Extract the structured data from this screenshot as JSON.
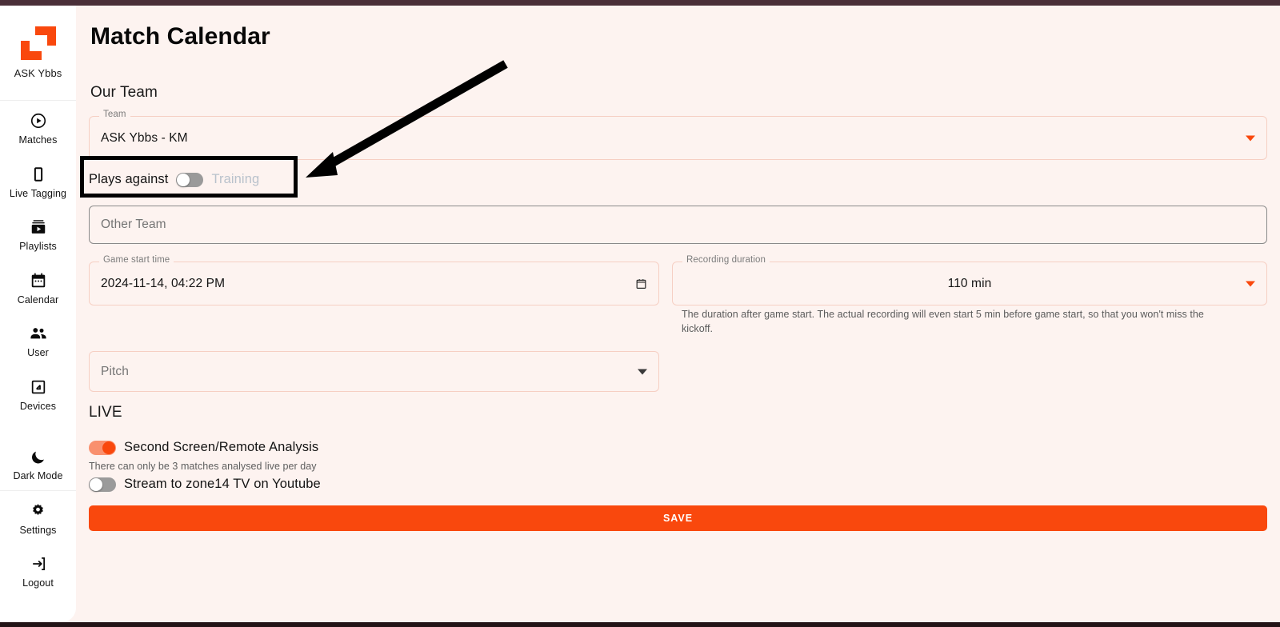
{
  "app": {
    "brand_name": "ASK Ybbs",
    "logo_color": "#f9480d",
    "accent_color": "#f9480d",
    "background_color": "#fdf3f0",
    "sidebar_background": "#ffffff"
  },
  "sidebar": {
    "groups": [
      {
        "items": [
          {
            "label": "Matches",
            "icon": "play-circle-icon"
          },
          {
            "label": "Live Tagging",
            "icon": "phone-icon"
          },
          {
            "label": "Playlists",
            "icon": "video-library-icon"
          },
          {
            "label": "Calendar",
            "icon": "calendar-icon"
          },
          {
            "label": "User",
            "icon": "people-icon"
          },
          {
            "label": "Devices",
            "icon": "device-frame-icon"
          },
          {
            "label": "Dark Mode",
            "icon": "moon-icon"
          }
        ]
      },
      {
        "items": [
          {
            "label": "Settings",
            "icon": "gear-icon"
          },
          {
            "label": "Logout",
            "icon": "logout-arrow-icon"
          }
        ]
      }
    ]
  },
  "page": {
    "title": "Match Calendar",
    "our_team_heading": "Our Team",
    "live_heading": "LIVE"
  },
  "form": {
    "team": {
      "label": "Team",
      "value": "ASK Ybbs - KM",
      "dropdown_icon": "chevron-down-icon"
    },
    "plays_against": {
      "prefix_label": "Plays against",
      "toggle_state": "off",
      "suffix_label": "Training"
    },
    "other_team": {
      "placeholder": "Other Team",
      "value": ""
    },
    "game_start_time": {
      "label": "Game start time",
      "value": "2024-11-14, 04:22 PM",
      "trailing_icon": "calendar-picker-icon"
    },
    "recording_duration": {
      "label": "Recording duration",
      "value": "110 min",
      "dropdown_icon": "chevron-down-icon",
      "helper_text": "The duration after game start. The actual recording will even start 5 min before game start, so that you won't miss the kickoff."
    },
    "pitch": {
      "placeholder": "Pitch",
      "dropdown_icon": "chevron-down-icon"
    }
  },
  "live": {
    "second_screen": {
      "label": "Second Screen/Remote Analysis",
      "toggle_state": "on",
      "note": "There can only be 3 matches analysed live per day"
    },
    "youtube_stream": {
      "label": "Stream to zone14 TV on Youtube",
      "toggle_state": "off"
    }
  },
  "actions": {
    "save_label": "SAVE"
  },
  "annotation": {
    "highlight_target": "plays-against-toggle",
    "arrow_color": "#000000",
    "box_color": "#000000"
  }
}
